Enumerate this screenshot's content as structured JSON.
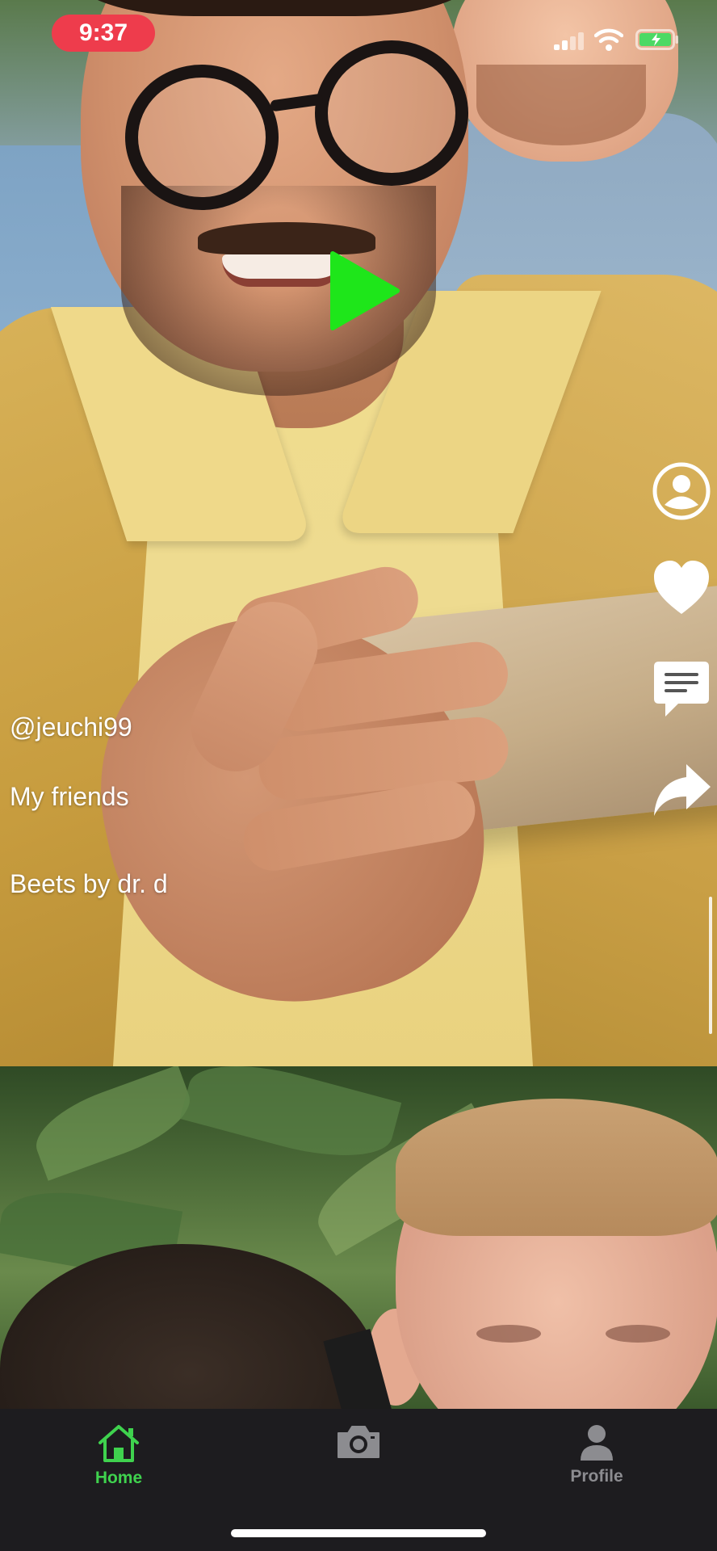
{
  "status_bar": {
    "time": "9:37",
    "time_pill_color": "#ee3c4c",
    "icons": [
      "cellular-signal-icon",
      "wifi-icon",
      "battery-charging-icon"
    ]
  },
  "feed": {
    "current_video": {
      "username": "@jeuchi99",
      "description": "My friends",
      "song": "Beets by dr. d",
      "paused": true,
      "play_button_color": "#1ee61a"
    },
    "side_actions": [
      {
        "name": "profile",
        "icon": "user-circle-icon"
      },
      {
        "name": "like",
        "icon": "heart-icon"
      },
      {
        "name": "comment",
        "icon": "comment-icon"
      },
      {
        "name": "share",
        "icon": "share-arrow-icon"
      }
    ]
  },
  "tab_bar": {
    "tabs": [
      {
        "label": "Home",
        "icon": "home-icon",
        "active": true
      },
      {
        "label": "",
        "icon": "camera-icon",
        "active": false
      },
      {
        "label": "Profile",
        "icon": "person-icon",
        "active": false
      }
    ],
    "active_color": "#3fd24e",
    "inactive_color": "#8c8c90",
    "background": "#1d1c1f"
  }
}
